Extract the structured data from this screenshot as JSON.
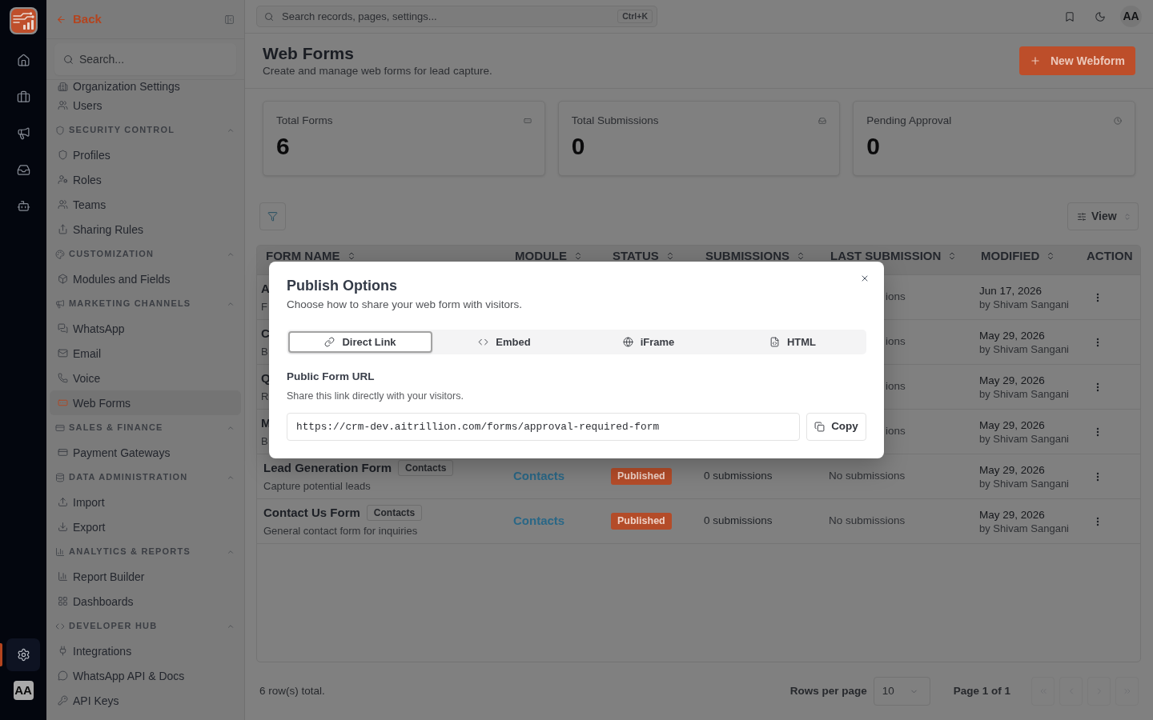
{
  "rail": {
    "items": [
      {
        "selected": false
      },
      {
        "selected": false
      },
      {
        "selected": false
      },
      {
        "selected": false
      },
      {
        "selected": false
      }
    ],
    "settings": {
      "selected": true
    },
    "avatar": "AA"
  },
  "sidebar": {
    "back": "Back",
    "search": {
      "placeholder": "Search..."
    },
    "sections": [
      {
        "items": [
          {
            "label": "Organization Settings",
            "selected": false
          },
          {
            "label": "Users",
            "selected": false
          }
        ]
      },
      {
        "heading": "SECURITY CONTROL",
        "expanded": true,
        "items": [
          {
            "label": "Profiles",
            "selected": false
          },
          {
            "label": "Roles",
            "selected": false
          },
          {
            "label": "Teams",
            "selected": false
          },
          {
            "label": "Sharing Rules",
            "selected": false
          }
        ]
      },
      {
        "heading": "CUSTOMIZATION",
        "expanded": true,
        "items": [
          {
            "label": "Modules and Fields",
            "selected": false
          }
        ]
      },
      {
        "heading": "MARKETING CHANNELS",
        "expanded": true,
        "items": [
          {
            "label": "WhatsApp",
            "selected": false
          },
          {
            "label": "Email",
            "selected": false
          },
          {
            "label": "Voice",
            "selected": false
          },
          {
            "label": "Web Forms",
            "selected": true
          }
        ]
      },
      {
        "heading": "SALES & FINANCE",
        "expanded": true,
        "items": [
          {
            "label": "Payment Gateways",
            "selected": false
          }
        ]
      },
      {
        "heading": "DATA ADMINISTRATION",
        "expanded": true,
        "items": [
          {
            "label": "Import",
            "selected": false
          },
          {
            "label": "Export",
            "selected": false
          }
        ]
      },
      {
        "heading": "ANALYTICS & REPORTS",
        "expanded": true,
        "items": [
          {
            "label": "Report Builder",
            "selected": false
          },
          {
            "label": "Dashboards",
            "selected": false
          }
        ]
      },
      {
        "heading": "DEVELOPER HUB",
        "expanded": true,
        "items": [
          {
            "label": "Integrations",
            "selected": false
          },
          {
            "label": "WhatsApp API & Docs",
            "selected": false
          },
          {
            "label": "API Keys",
            "selected": false
          }
        ]
      }
    ]
  },
  "topbar": {
    "search": {
      "placeholder": "Search records, pages, settings...",
      "shortcut": "Ctrl+K"
    },
    "avatar": "AA"
  },
  "header": {
    "title": "Web Forms",
    "subtitle": "Create and manage web forms for lead capture.",
    "primary_button": "New Webform"
  },
  "stats": [
    {
      "label": "Total Forms",
      "value": "6"
    },
    {
      "label": "Total Submissions",
      "value": "0"
    },
    {
      "label": "Pending Approval",
      "value": "0"
    }
  ],
  "toolbar": {
    "view_button": "View"
  },
  "table": {
    "columns": [
      {
        "label": "FORM NAME",
        "sortable": true
      },
      {
        "label": "MODULE",
        "sortable": true
      },
      {
        "label": "STATUS",
        "sortable": true
      },
      {
        "label": "SUBMISSIONS",
        "sortable": true
      },
      {
        "label": "LAST SUBMISSION",
        "sortable": true
      },
      {
        "label": "MODIFIED",
        "sortable": true
      },
      {
        "label": "ACTION",
        "sortable": false
      }
    ],
    "rows": [
      {
        "kind": "covered",
        "name": "A",
        "description": "F",
        "last_submission": "ions",
        "modified": "Jun 17, 2026",
        "modified_by": "by Shivam Sangani"
      },
      {
        "kind": "covered",
        "name": "C",
        "description": "B",
        "last_submission": "ions",
        "modified": "May 29, 2026",
        "modified_by": "by Shivam Sangani"
      },
      {
        "kind": "covered",
        "name": "Q",
        "description": "R",
        "last_submission": "ions",
        "modified": "May 29, 2026",
        "modified_by": "by Shivam Sangani"
      },
      {
        "kind": "covered",
        "name": "M",
        "description": "B",
        "last_submission": "ions",
        "modified": "May 29, 2026",
        "modified_by": "by Shivam Sangani"
      },
      {
        "kind": "full",
        "name": "Lead Generation Form",
        "tag": "Contacts",
        "description": "Capture potential leads",
        "module": "Contacts",
        "status": "Published",
        "submissions": "0 submissions",
        "last_submission": "No submissions",
        "modified": "May 29, 2026",
        "modified_by": "by Shivam Sangani"
      },
      {
        "kind": "full",
        "name": "Contact Us Form",
        "tag": "Contacts",
        "description": "General contact form for inquiries",
        "module": "Contacts",
        "status": "Published",
        "submissions": "0 submissions",
        "last_submission": "No submissions",
        "modified": "May 29, 2026",
        "modified_by": "by Shivam Sangani"
      }
    ]
  },
  "footer": {
    "total": "6 row(s) total.",
    "rows_per_page_label": "Rows per page",
    "rows_per_page": "10",
    "page": "Page 1 of 1",
    "pagination": [
      {
        "disabled": true
      },
      {
        "disabled": true
      },
      {
        "disabled": true
      },
      {
        "disabled": true
      }
    ]
  },
  "modal": {
    "title": "Publish Options",
    "subtitle": "Choose how to share your web form with visitors.",
    "tabs": [
      {
        "label": "Direct Link",
        "selected": true
      },
      {
        "label": "Embed",
        "selected": false
      },
      {
        "label": "iFrame",
        "selected": false
      },
      {
        "label": "HTML",
        "selected": false
      }
    ],
    "field_label": "Public Form URL",
    "field_hint": "Share this link directly with your visitors.",
    "url": "https://crm-dev.aitrillion.com/forms/approval-required-form",
    "copy_button": "Copy"
  }
}
